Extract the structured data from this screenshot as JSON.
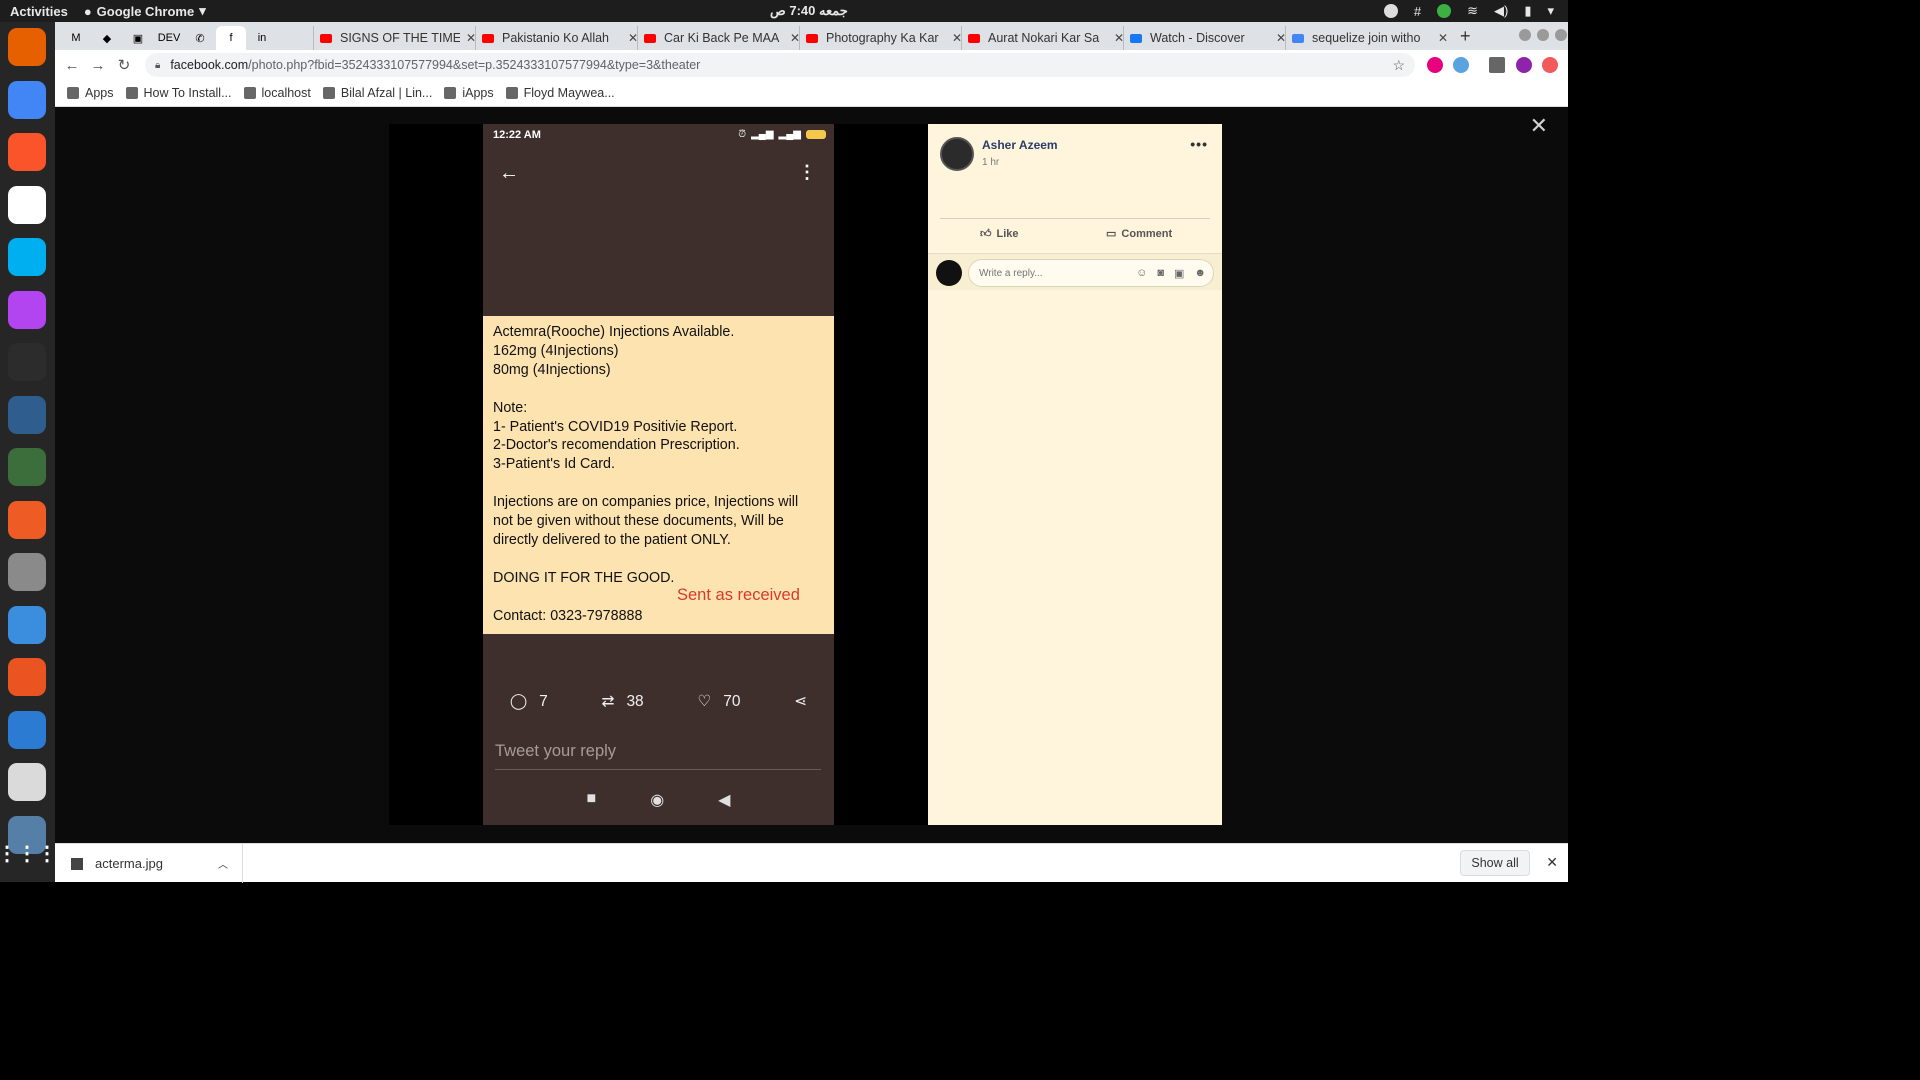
{
  "topbar": {
    "activities": "Activities",
    "app": "Google Chrome",
    "clock": "جمعه 7:40 ص"
  },
  "dock": {
    "items": [
      {
        "name": "firefox-icon",
        "color": "#e66000"
      },
      {
        "name": "chrome-icon",
        "color": "#4285f4"
      },
      {
        "name": "brave-icon",
        "color": "#fb542b"
      },
      {
        "name": "slack-icon",
        "color": "#ffffff"
      },
      {
        "name": "skype-icon",
        "color": "#00aff0"
      },
      {
        "name": "phpstorm-icon",
        "color": "#b345f1"
      },
      {
        "name": "terminal-icon",
        "color": "#2c2c2c"
      },
      {
        "name": "mysql-workbench-icon",
        "color": "#2f5e8e"
      },
      {
        "name": "robo3t-icon",
        "color": "#3b6e3b"
      },
      {
        "name": "postman-icon",
        "color": "#ef5b25"
      },
      {
        "name": "files-icon",
        "color": "#8a8a8a"
      },
      {
        "name": "help-icon",
        "color": "#3b8ede"
      },
      {
        "name": "software-center-icon",
        "color": "#e95420"
      },
      {
        "name": "thunderbird-icon",
        "color": "#2a7bd1"
      },
      {
        "name": "rhythmbox-icon",
        "color": "#dadada"
      },
      {
        "name": "screen-icon",
        "color": "#557fa6"
      }
    ]
  },
  "tabs": [
    {
      "label": "SIGNS OF THE TIMES",
      "fav": "#ff0000"
    },
    {
      "label": "Pakistanio Ko Allah",
      "fav": "#ff0000"
    },
    {
      "label": "Car Ki Back Pe MAA",
      "fav": "#ff0000"
    },
    {
      "label": "Photography Ka Kar",
      "fav": "#ff0000"
    },
    {
      "label": "Aurat Nokari Kar Sa",
      "fav": "#ff0000"
    },
    {
      "label": "Watch - Discover",
      "fav": "#1877f2"
    },
    {
      "label": "sequelize join witho",
      "fav": "#4285f4"
    }
  ],
  "pinned_tabs": [
    "M",
    "◆",
    "▣",
    "DEV",
    "✆",
    "f",
    "in"
  ],
  "toolbar": {
    "url_host": "facebook.com",
    "url_path": "/photo.php?fbid=3524333107577994&set=p.3524333107577994&type=3&theater"
  },
  "bookmarks": [
    {
      "label": "Apps"
    },
    {
      "label": "How To Install..."
    },
    {
      "label": "localhost"
    },
    {
      "label": "Bilal Afzal | Lin..."
    },
    {
      "label": "iApps"
    },
    {
      "label": "Floyd Maywea..."
    }
  ],
  "phone": {
    "time": "12:22 AM",
    "battery": "60",
    "note_lines": [
      "Actemra(Rooche) Injections Available.",
      "162mg (4Injections)",
      "80mg (4Injections)",
      "",
      "Note:",
      "1- Patient's COVID19 Positivie Report.",
      "2-Doctor's recomendation Prescription.",
      "3-Patient's Id Card.",
      "",
      "Injections are on companies price, Injections will",
      "not be given without these documents, Will be",
      "directly delivered to the patient ONLY.",
      "",
      "DOING IT FOR THE GOOD.",
      "",
      "Contact: 0323-7978888"
    ],
    "watermark": "Sent as received",
    "replies": "7",
    "retweets": "38",
    "likes": "70",
    "reply_placeholder": "Tweet your reply"
  },
  "post": {
    "author": "Asher Azeem",
    "time": "1 hr",
    "like_label": "Like",
    "comment_label": "Comment",
    "reply_placeholder": "Write a reply..."
  },
  "download": {
    "filename": "acterma.jpg",
    "show_all": "Show all"
  }
}
